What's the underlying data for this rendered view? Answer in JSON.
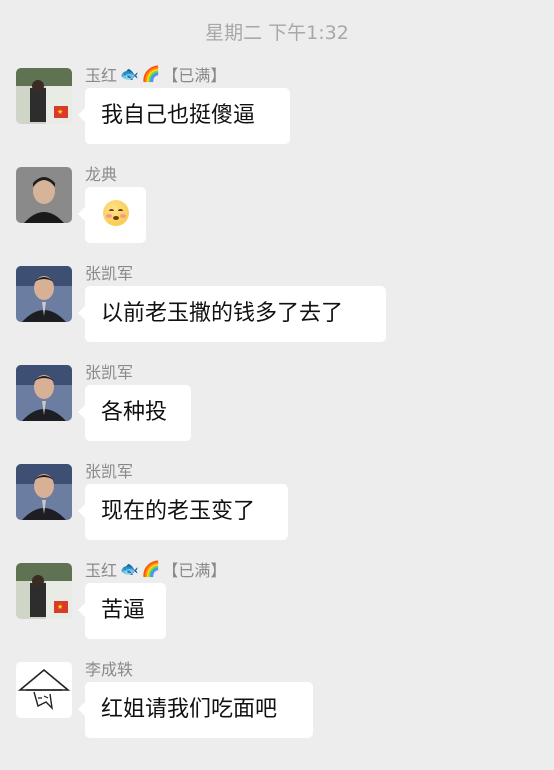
{
  "timestamp": "星期二 下午1:32",
  "messages": [
    {
      "sender": "玉红",
      "tag": "【已满】",
      "text": "我自己也挺傻逼",
      "avatar": "photo-avatar-flag"
    },
    {
      "sender": "龙典",
      "text": "",
      "emoji": "smiling-face-emoji",
      "avatar": "photo-avatar"
    },
    {
      "sender": "张凯军",
      "text": "以前老玉撒的钱多了去了",
      "avatar": "photo-avatar"
    },
    {
      "sender": "张凯军",
      "text": "各种投",
      "avatar": "photo-avatar"
    },
    {
      "sender": "张凯军",
      "text": "现在的老玉变了",
      "avatar": "photo-avatar"
    },
    {
      "sender": "玉红",
      "tag": "【已满】",
      "text": "苦逼",
      "avatar": "photo-avatar-flag"
    },
    {
      "sender": "李成轶",
      "text": "红姐请我们吃面吧",
      "avatar": "sketch-avatar"
    }
  ],
  "colors": {
    "background": "#ededed",
    "bubble": "#ffffff",
    "name": "#8a8a8a"
  }
}
